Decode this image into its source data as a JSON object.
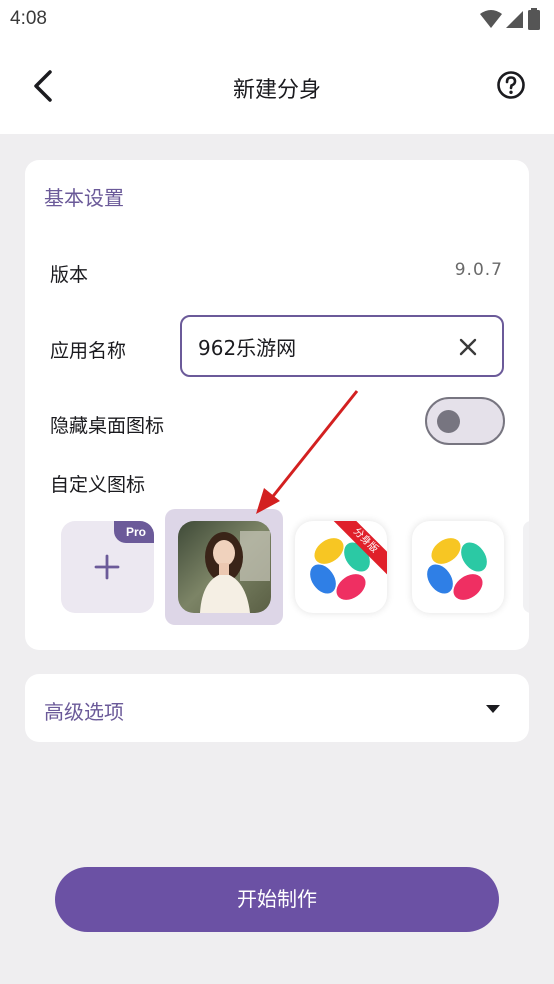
{
  "status_bar": {
    "time": "4:08"
  },
  "header": {
    "title": "新建分身"
  },
  "basic": {
    "section_title": "基本设置",
    "version_label": "版本",
    "version_value": "9.0.7",
    "app_name_label": "应用名称",
    "app_name_value": "962乐游网",
    "hide_icon_label": "隐藏桌面图标",
    "hide_icon_enabled": false,
    "custom_icon_label": "自定义图标",
    "pro_badge": "Pro",
    "clone_ribbon_text": "分身版"
  },
  "advanced": {
    "label": "高级选项"
  },
  "actions": {
    "start_label": "开始制作"
  },
  "colors": {
    "accent": "#6b5a99",
    "button": "#6b51a4",
    "annotation_arrow": "#d32020"
  }
}
